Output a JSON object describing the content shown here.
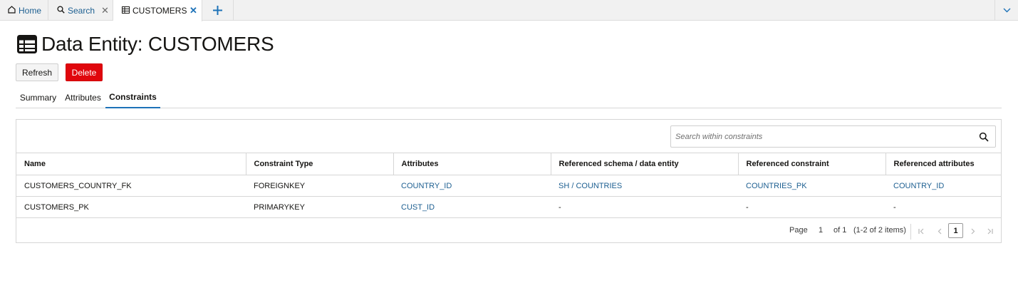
{
  "tabs": {
    "home": "Home",
    "search": "Search",
    "customers": "CUSTOMERS"
  },
  "page": {
    "title": "Data Entity: CUSTOMERS"
  },
  "toolbar": {
    "refresh_label": "Refresh",
    "delete_label": "Delete"
  },
  "subtabs": [
    "Summary",
    "Attributes",
    "Constraints"
  ],
  "search": {
    "placeholder": "Search within constraints"
  },
  "table": {
    "columns": [
      "Name",
      "Constraint Type",
      "Attributes",
      "Referenced schema / data entity",
      "Referenced constraint",
      "Referenced attributes"
    ],
    "rows": [
      [
        "CUSTOMERS_COUNTRY_FK",
        "FOREIGNKEY",
        "COUNTRY_ID",
        "SH / COUNTRIES",
        "COUNTRIES_PK",
        "COUNTRY_ID"
      ],
      [
        "CUSTOMERS_PK",
        "PRIMARYKEY",
        "CUST_ID",
        "-",
        "-",
        "-"
      ]
    ]
  },
  "pagination": {
    "page_label": "Page",
    "current_page": "1",
    "of_total": "of 1",
    "items_summary": "(1-2 of 2 items)",
    "page_button": "1"
  },
  "colors": {
    "accent": "#1d72b8",
    "link": "#1d5f91",
    "delete": "#e0070d"
  }
}
